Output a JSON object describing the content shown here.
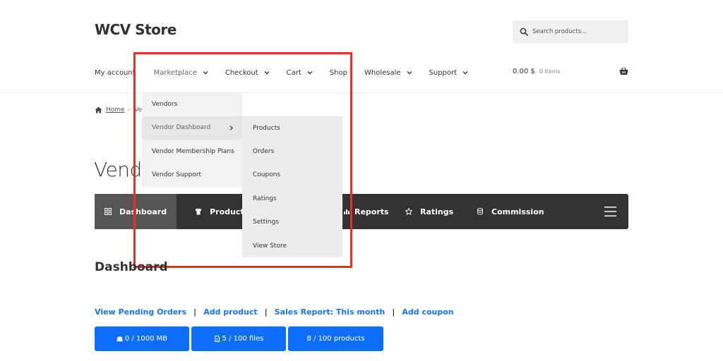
{
  "site": {
    "logo": "WCV Store"
  },
  "search": {
    "placeholder": "Search products…"
  },
  "nav": {
    "items": [
      {
        "label": "My account"
      },
      {
        "label": "Marketplace"
      },
      {
        "label": "Checkout"
      },
      {
        "label": "Cart"
      },
      {
        "label": "Shop"
      },
      {
        "label": "Wholesale"
      },
      {
        "label": "Support"
      }
    ]
  },
  "cart": {
    "total": "0.00 $",
    "items": "0 items"
  },
  "breadcrumb": {
    "home": "Home",
    "current": "Ven"
  },
  "page": {
    "title": "Vendo"
  },
  "marketplace_menu": {
    "items": [
      {
        "label": "Vendors"
      },
      {
        "label": "Vendor Dashboard"
      },
      {
        "label": "Vendor Membership Plans"
      },
      {
        "label": "Vendor Support"
      }
    ]
  },
  "vendor_dashboard_menu": {
    "items": [
      {
        "label": "Products"
      },
      {
        "label": "Orders"
      },
      {
        "label": "Coupons"
      },
      {
        "label": "Ratings"
      },
      {
        "label": "Settings"
      },
      {
        "label": "View Store"
      }
    ]
  },
  "dashbar": {
    "tabs": [
      {
        "label": "Dashboard",
        "icon": "grid-icon"
      },
      {
        "label": "Products",
        "icon": "shirt-icon"
      },
      {
        "label": "Reports",
        "icon": "chart-icon"
      },
      {
        "label": "Ratings",
        "icon": "star-icon"
      },
      {
        "label": "Commission",
        "icon": "coins-icon"
      }
    ]
  },
  "dashboard": {
    "title": "Dashboard",
    "links": {
      "pending_orders": "View Pending Orders",
      "add_product": "Add product",
      "sales_report": "Sales Report: This month",
      "add_coupon": "Add coupon",
      "separator": "|"
    },
    "stats": {
      "storage": "0 / 1000 MB",
      "files": "5 / 100 files",
      "products": "8 / 100 products"
    }
  },
  "colors": {
    "accent": "#0d6efd",
    "link": "#1a73e8",
    "dashbar_bg": "#333333",
    "highlight": "#e8311f"
  }
}
